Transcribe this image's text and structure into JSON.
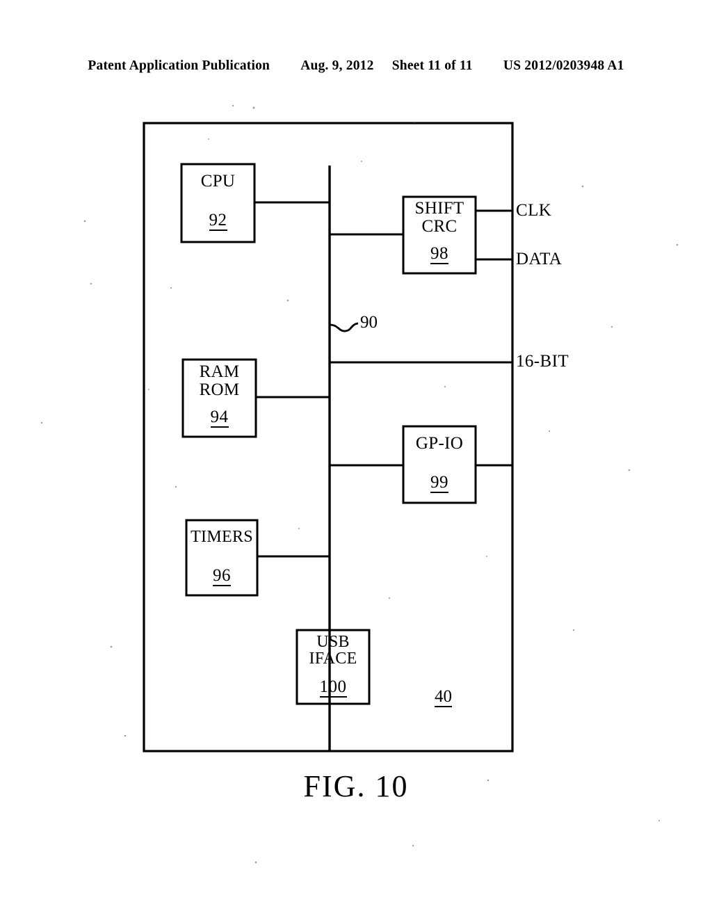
{
  "header": {
    "publication": "Patent Application Publication",
    "date": "Aug. 9, 2012",
    "sheet": "Sheet 11 of 11",
    "docnum": "US 2012/0203948 A1"
  },
  "figure": {
    "caption": "FIG. 10",
    "enclosure_ref": "40",
    "bus_ref": "90",
    "blocks": [
      {
        "id": "cpu",
        "line1": "CPU",
        "line2": "",
        "ref": "92"
      },
      {
        "id": "shift",
        "line1": "SHIFT",
        "line2": "CRC",
        "ref": "98"
      },
      {
        "id": "ram",
        "line1": "RAM",
        "line2": "ROM",
        "ref": "94"
      },
      {
        "id": "gpio",
        "line1": "GP-IO",
        "line2": "",
        "ref": "99"
      },
      {
        "id": "timers",
        "line1": "TIMERS",
        "line2": "",
        "ref": "96"
      },
      {
        "id": "usb",
        "line1": "USB",
        "line2": "IFACE",
        "ref": "100"
      }
    ],
    "signals": [
      {
        "id": "clk",
        "label": "CLK"
      },
      {
        "id": "data",
        "label": "DATA"
      },
      {
        "id": "bus16",
        "label": "16-BIT"
      }
    ]
  },
  "colors": {
    "ink": "#000000",
    "paper": "#ffffff"
  }
}
